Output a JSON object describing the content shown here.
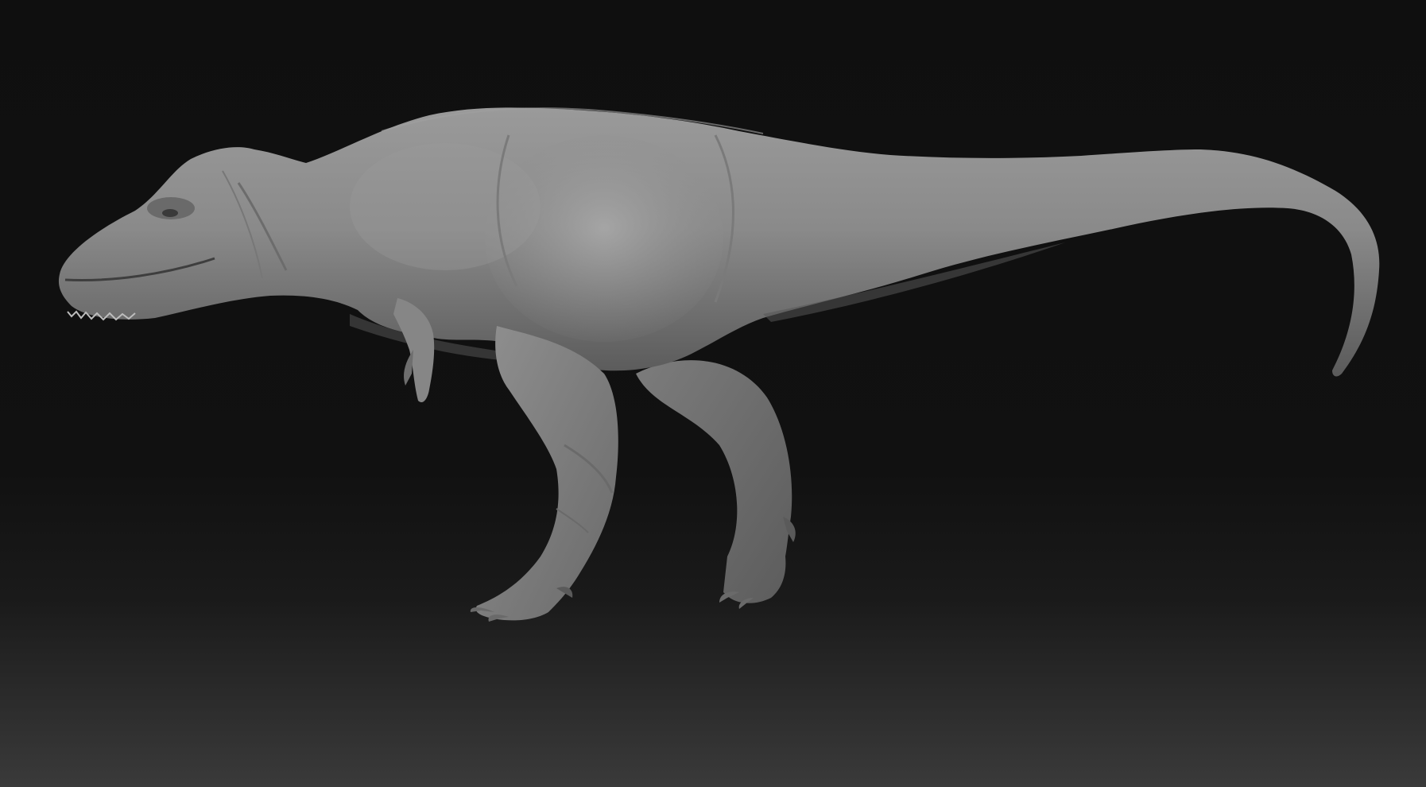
{
  "scene": {
    "subject": "sculpted-dinosaur-model",
    "material_color": "#8a8a8a",
    "highlight_color": "#a6a6a6",
    "shadow_color": "#4a4a4a",
    "background_top": "#0f0f0f",
    "background_bottom": "#3a3a3a"
  }
}
